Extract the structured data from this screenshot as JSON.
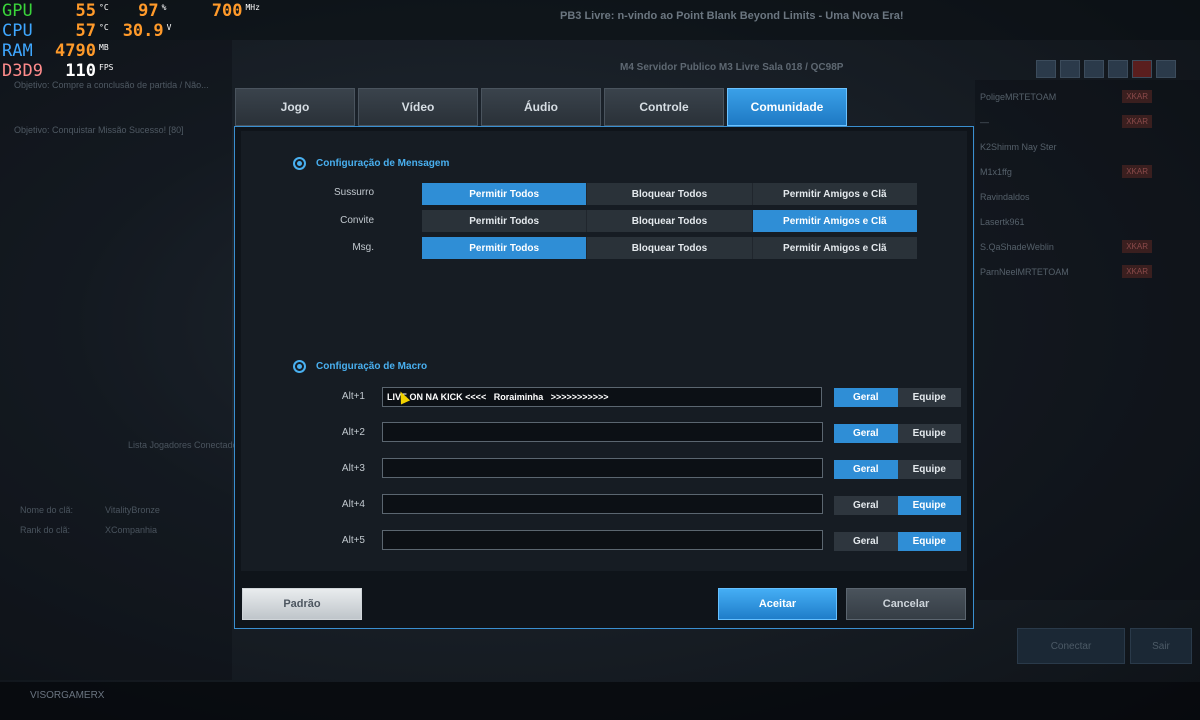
{
  "hud": {
    "gpu": {
      "label": "GPU",
      "temp": "55",
      "temp_unit": "°C",
      "load": "97",
      "load_unit": "%",
      "clock": "700",
      "clock_unit": "MHz"
    },
    "cpu": {
      "label": "CPU",
      "temp": "57",
      "temp_unit": "°C",
      "voltage": "30.9",
      "voltage_unit": "V"
    },
    "ram": {
      "label": "RAM",
      "value": "4790",
      "unit": "MB"
    },
    "d3d9": {
      "label": "D3D9",
      "value": "110",
      "unit": "FPS"
    }
  },
  "background": {
    "title": "PB3 Livre: n-vindo ao Point Blank Beyond Limits - Uma Nova Era!",
    "server": "M4 Servidor Publico M3 Livre Sala 018 / QC98P",
    "objective_1": "Objetivo: Compre a conclusão de partida / Não...",
    "objective_2": "Objetivo: Conquistar Missão Sucesso! [80]",
    "players": [
      "PoligeMRTETOAM",
      "—",
      "K2Shimm Nay Ster",
      "M1x1ffg",
      "Ravindaldos",
      "Lasertk961",
      "S.QaShadeWeblin",
      "ParnNeelMRTETOAM"
    ],
    "tag": "XKAR",
    "clan_name_label": "Nome do clã:",
    "clan_name": "VitalityBronze",
    "clan_rank_label": "Rank do clã:",
    "clan_rank": "XCompanhia",
    "chat_label": "Lista Jogadores Conectados",
    "player_name": "VISORGAMERX",
    "connect_label": "Conectar",
    "exit_label": "Sair"
  },
  "tabs": [
    {
      "label": "Jogo",
      "active": false
    },
    {
      "label": "Vídeo",
      "active": false
    },
    {
      "label": "Áudio",
      "active": false
    },
    {
      "label": "Controle",
      "active": false
    },
    {
      "label": "Comunidade",
      "active": true
    }
  ],
  "message_section": {
    "title": "Configuração de Mensagem",
    "options": [
      "Permitir Todos",
      "Bloquear Todos",
      "Permitir Amigos e Clã"
    ],
    "rows": [
      {
        "label": "Sussurro",
        "selected": 0
      },
      {
        "label": "Convite",
        "selected": 2
      },
      {
        "label": "Msg.",
        "selected": 0
      }
    ]
  },
  "macro_section": {
    "title": "Configuração de Macro",
    "toggle_options": [
      "Geral",
      "Equipe"
    ],
    "rows": [
      {
        "label": "Alt+1",
        "value": "LIVE ON NA KICK <<<<   Roraiminha   >>>>>>>>>>>",
        "selected": 0
      },
      {
        "label": "Alt+2",
        "value": "",
        "selected": 0
      },
      {
        "label": "Alt+3",
        "value": "",
        "selected": 0
      },
      {
        "label": "Alt+4",
        "value": "",
        "selected": 1
      },
      {
        "label": "Alt+5",
        "value": "",
        "selected": 1
      }
    ]
  },
  "footer": {
    "default_label": "Padrão",
    "accept_label": "Aceitar",
    "cancel_label": "Cancelar"
  },
  "colors": {
    "accent": "#2f8ed6",
    "section_title": "#49b0f0",
    "hud_value": "#ff9a2a",
    "hud_gpu_label": "#3ad43a",
    "hud_cpu_label": "#3fa7ff",
    "hud_ram_label": "#3fa7ff",
    "hud_d3d_label": "#ff8c8c"
  }
}
